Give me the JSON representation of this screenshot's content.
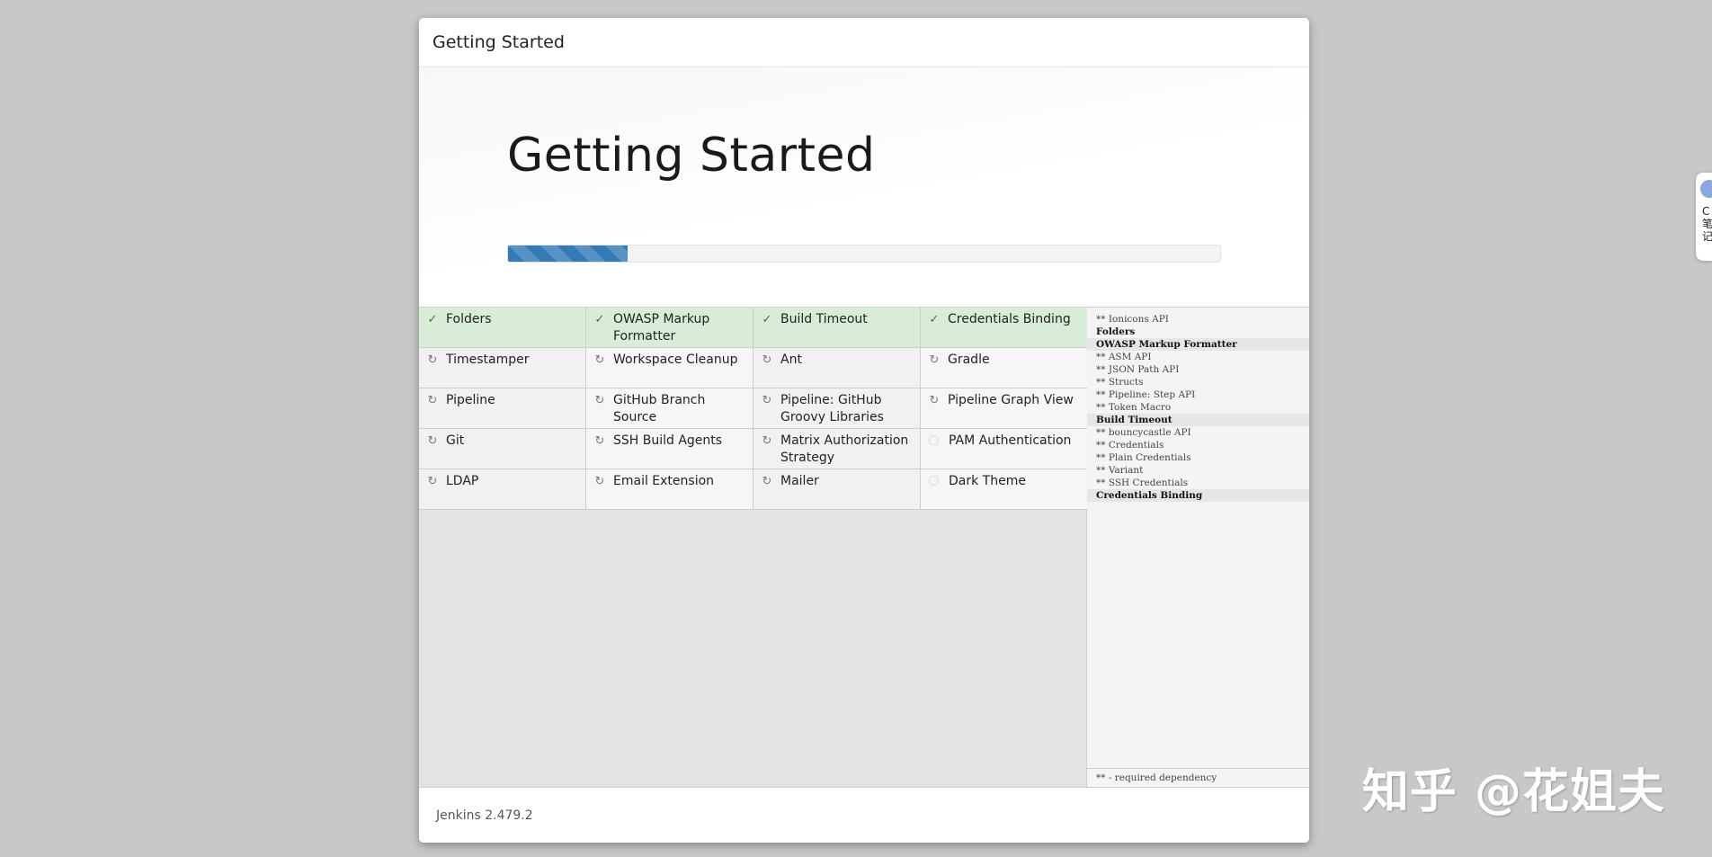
{
  "dialog": {
    "header_title": "Getting Started",
    "hero_title": "Getting Started",
    "progress_fraction": 0.168
  },
  "plugins": [
    {
      "name": "Folders",
      "status": "success"
    },
    {
      "name": "OWASP Markup Formatter",
      "status": "success"
    },
    {
      "name": "Build Timeout",
      "status": "success"
    },
    {
      "name": "Credentials Binding",
      "status": "success"
    },
    {
      "name": "Timestamper",
      "status": "pending"
    },
    {
      "name": "Workspace Cleanup",
      "status": "pending"
    },
    {
      "name": "Ant",
      "status": "pending"
    },
    {
      "name": "Gradle",
      "status": "pending"
    },
    {
      "name": "Pipeline",
      "status": "pending"
    },
    {
      "name": "GitHub Branch Source",
      "status": "pending"
    },
    {
      "name": "Pipeline: GitHub Groovy Libraries",
      "status": "pending"
    },
    {
      "name": "Pipeline Graph View",
      "status": "pending"
    },
    {
      "name": "Git",
      "status": "pending"
    },
    {
      "name": "SSH Build Agents",
      "status": "pending"
    },
    {
      "name": "Matrix Authorization Strategy",
      "status": "pending"
    },
    {
      "name": "PAM Authentication",
      "status": "not-started"
    },
    {
      "name": "LDAP",
      "status": "pending"
    },
    {
      "name": "Email Extension",
      "status": "pending"
    },
    {
      "name": "Mailer",
      "status": "pending"
    },
    {
      "name": "Dark Theme",
      "status": "not-started"
    }
  ],
  "log": {
    "lines": [
      {
        "text": "** Ionicons API",
        "kind": "dependency"
      },
      {
        "text": "Folders",
        "kind": "plugin"
      },
      {
        "text": "OWASP Markup Formatter",
        "kind": "plugin-shaded"
      },
      {
        "text": "** ASM API",
        "kind": "dependency"
      },
      {
        "text": "** JSON Path API",
        "kind": "dependency"
      },
      {
        "text": "** Structs",
        "kind": "dependency"
      },
      {
        "text": "** Pipeline: Step API",
        "kind": "dependency"
      },
      {
        "text": "** Token Macro",
        "kind": "dependency"
      },
      {
        "text": "Build Timeout",
        "kind": "plugin-shaded"
      },
      {
        "text": "** bouncycastle API",
        "kind": "dependency"
      },
      {
        "text": "** Credentials",
        "kind": "dependency"
      },
      {
        "text": "** Plain Credentials",
        "kind": "dependency"
      },
      {
        "text": "** Variant",
        "kind": "dependency"
      },
      {
        "text": "** SSH Credentials",
        "kind": "dependency"
      },
      {
        "text": "Credentials Binding",
        "kind": "plugin-shaded"
      }
    ],
    "footer": "** - required dependency"
  },
  "footer": {
    "version": "Jenkins 2.479.2"
  },
  "side_widget": {
    "text": "C\n笔\n记"
  },
  "watermark": "知乎 @花姐夫",
  "colors": {
    "progress": "#337ab7",
    "success_cell": "#d8ecd8",
    "checkmark": "#3c763d"
  },
  "icons": {
    "success": "check-icon",
    "pending": "refresh-icon",
    "not-started": "circle-icon"
  }
}
